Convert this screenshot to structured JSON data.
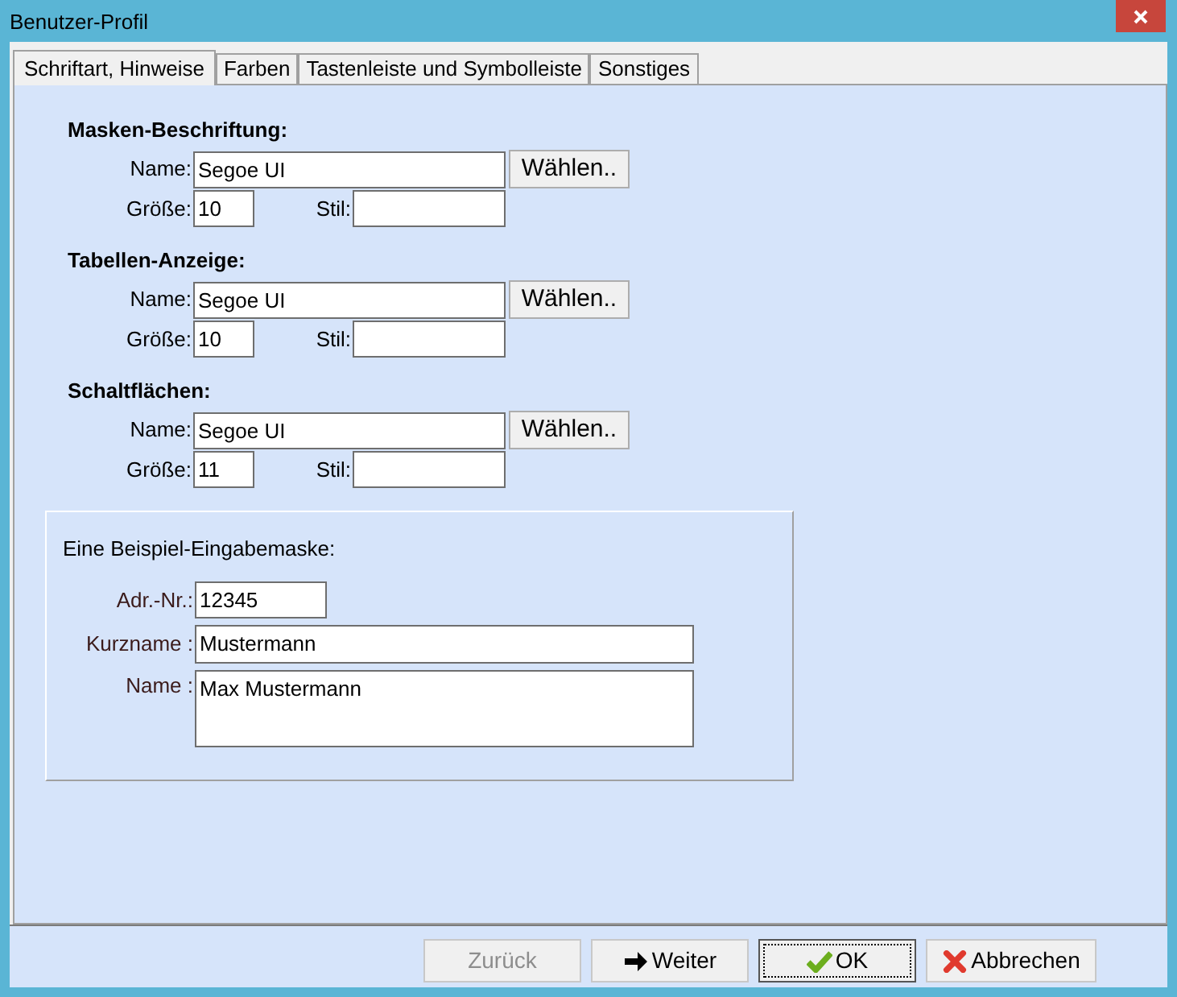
{
  "window": {
    "title": "Benutzer-Profil"
  },
  "tabs": [
    {
      "label": "Schriftart, Hinweise",
      "selected": true
    },
    {
      "label": "Farben",
      "selected": false
    },
    {
      "label": "Tastenleiste und Symbolleiste",
      "selected": false
    },
    {
      "label": "Sonstiges",
      "selected": false
    }
  ],
  "sections": [
    {
      "heading": "Masken-Beschriftung:",
      "name_label": "Name:",
      "name_value": "Segoe UI",
      "choose_button": "Wählen..",
      "size_label": "Größe:",
      "size_value": "10",
      "style_label": "Stil:"
    },
    {
      "heading": "Tabellen-Anzeige:",
      "name_label": "Name:",
      "name_value": "Segoe UI",
      "choose_button": "Wählen..",
      "size_label": "Größe:",
      "size_value": "10",
      "style_label": "Stil:"
    },
    {
      "heading": "Schaltflächen:",
      "name_label": "Name:",
      "name_value": "Segoe UI",
      "choose_button": "Wählen..",
      "size_label": "Größe:",
      "size_value": "11",
      "style_label": "Stil:"
    }
  ],
  "sample": {
    "heading": "Eine Beispiel-Eingabemaske:",
    "fields": [
      {
        "label": "Adr.-Nr.:",
        "value": "12345",
        "kind": "short"
      },
      {
        "label": "Kurzname :",
        "value": "Mustermann",
        "kind": "line"
      },
      {
        "label": "Name :",
        "value": "Max Mustermann",
        "kind": "multiline"
      }
    ]
  },
  "buttons": [
    {
      "label": "Zurück",
      "kind": "back",
      "disabled": true,
      "focused": false
    },
    {
      "label": "Weiter",
      "kind": "next",
      "disabled": false,
      "focused": false
    },
    {
      "label": "OK",
      "kind": "ok",
      "disabled": false,
      "focused": true
    },
    {
      "label": "Abbrechen",
      "kind": "cancel",
      "disabled": false,
      "focused": false
    }
  ]
}
